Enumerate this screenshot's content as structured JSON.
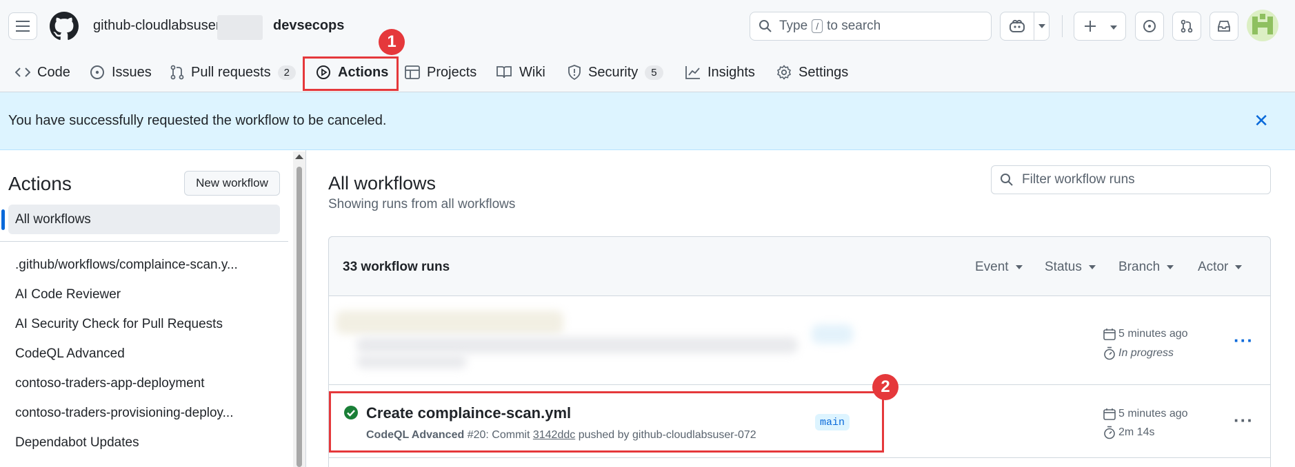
{
  "header": {
    "org": "github-cloudlabsuser",
    "repo": "devsecops",
    "search_prefix": "Type",
    "search_key": "/",
    "search_suffix": "to search"
  },
  "tabs": [
    {
      "label": "Code"
    },
    {
      "label": "Issues"
    },
    {
      "label": "Pull requests",
      "count": "2"
    },
    {
      "label": "Actions"
    },
    {
      "label": "Projects"
    },
    {
      "label": "Wiki"
    },
    {
      "label": "Security",
      "count": "5"
    },
    {
      "label": "Insights"
    },
    {
      "label": "Settings"
    }
  ],
  "annotations": {
    "one": "1",
    "two": "2"
  },
  "flash": {
    "message": "You have successfully requested the workflow to be canceled."
  },
  "sidebar": {
    "title": "Actions",
    "new_workflow": "New workflow",
    "active": "All workflows",
    "items": [
      ".github/workflows/complaince-scan.y...",
      "AI Code Reviewer",
      "AI Security Check for Pull Requests",
      "CodeQL Advanced",
      "contoso-traders-app-deployment",
      "contoso-traders-provisioning-deploy...",
      "Dependabot Updates"
    ]
  },
  "main": {
    "title": "All workflows",
    "subtitle": "Showing runs from all workflows",
    "filter_placeholder": "Filter workflow runs",
    "runs_count": "33 workflow runs",
    "filters": [
      "Event",
      "Status",
      "Branch",
      "Actor"
    ],
    "runs": [
      {
        "time": "5 minutes ago",
        "duration": "In progress"
      },
      {
        "title": "Create complaince-scan.yml",
        "workflow": "CodeQL Advanced",
        "run_number": "#20",
        "commit_prefix": ": Commit",
        "commit": "3142ddc",
        "pushed_by": "pushed by github-cloudlabsuser-072",
        "branch": "main",
        "time": "5 minutes ago",
        "duration": "2m 14s"
      }
    ]
  },
  "colors": {
    "accent": "#0969da",
    "annotation": "#e5383b",
    "success": "#1a7f37",
    "flash_bg": "#ddf4ff"
  }
}
